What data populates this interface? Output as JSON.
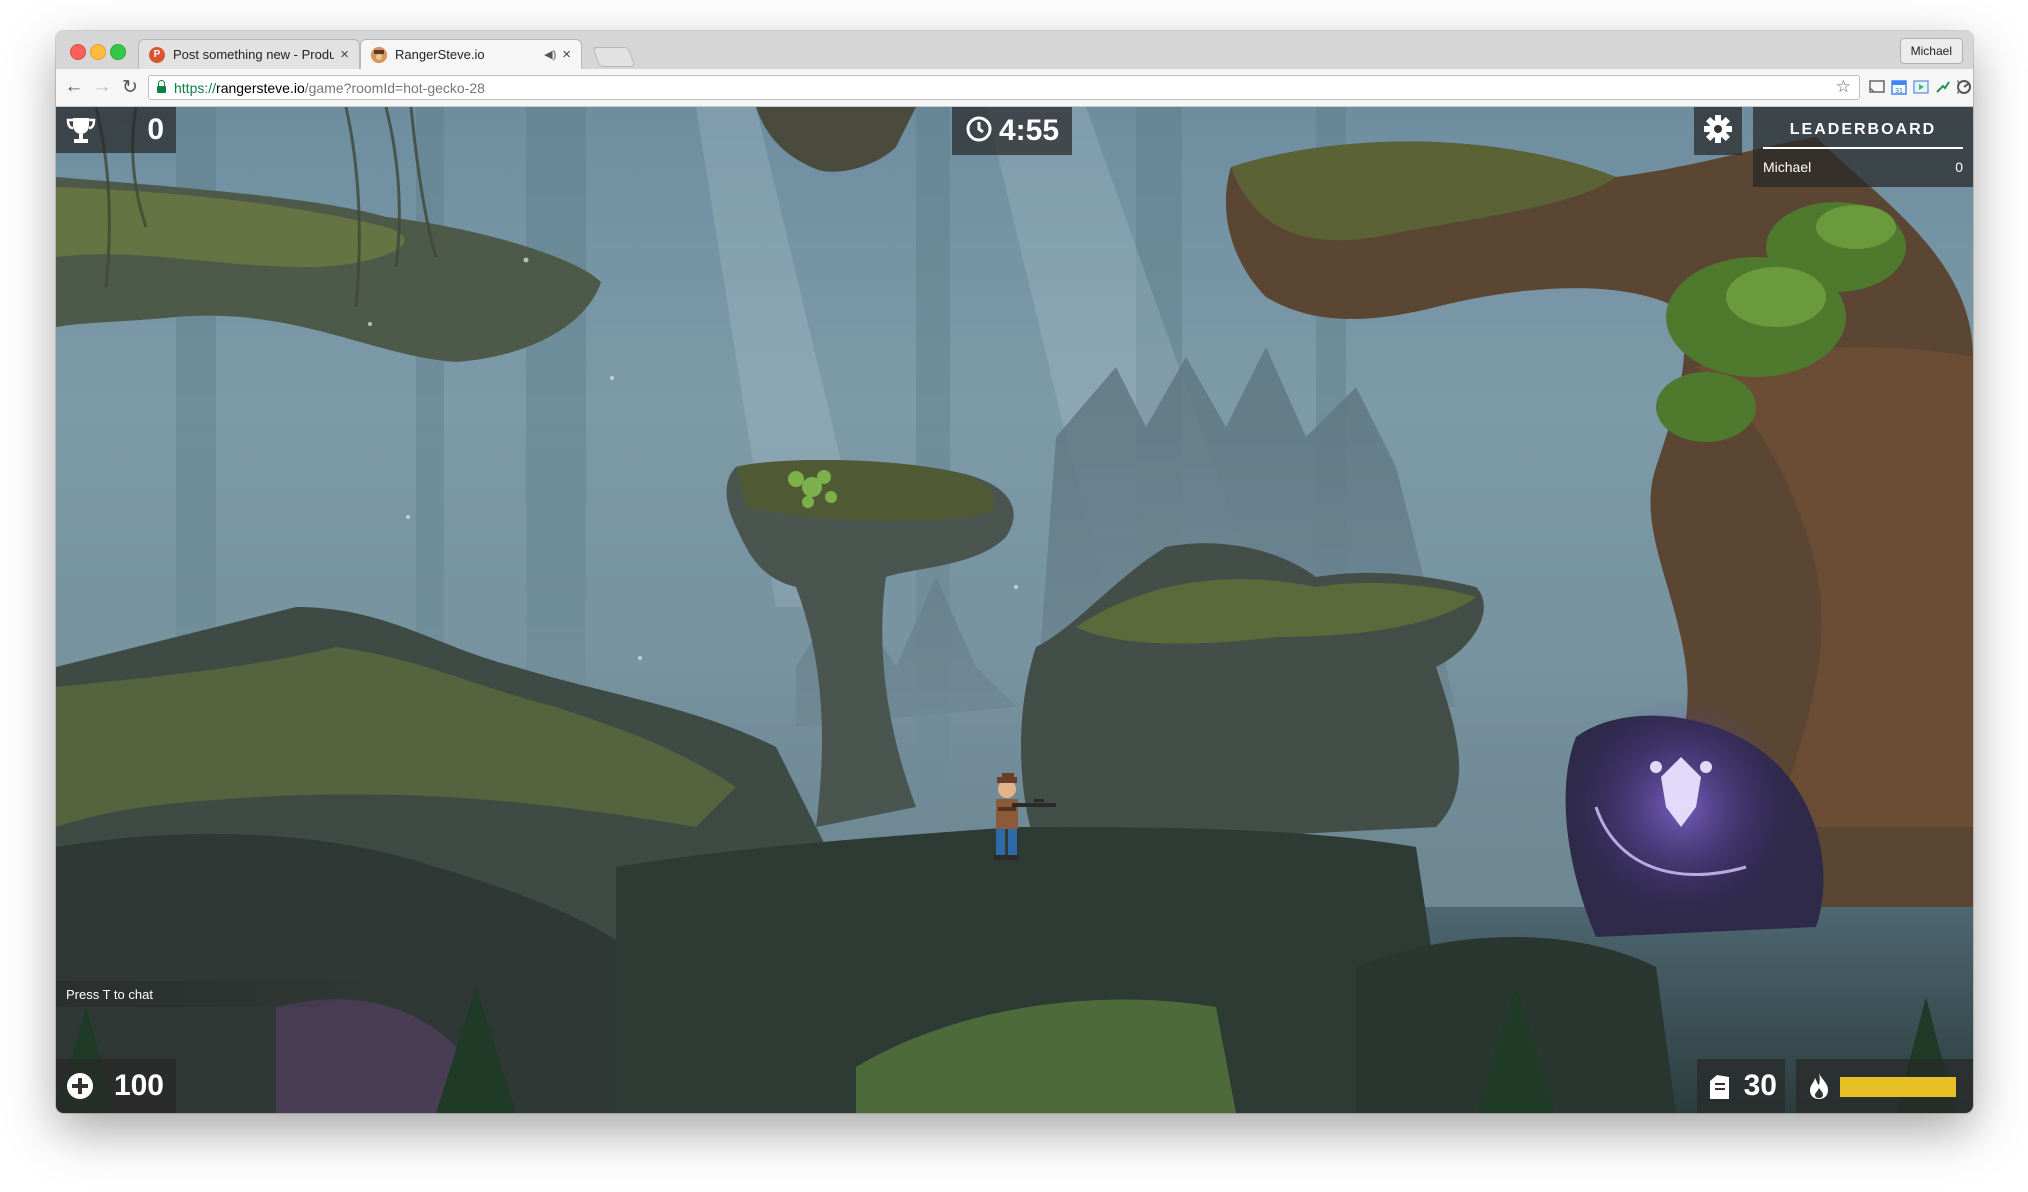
{
  "browser": {
    "tabs": [
      {
        "title": "Post something new - Product Hunt",
        "favicon_letter": "P",
        "favicon_color": "#da552f",
        "active": false
      },
      {
        "title": "RangerSteve.io",
        "active": true
      }
    ],
    "profile_name": "Michael",
    "url": {
      "scheme": "https://",
      "host": "rangersteve.io",
      "path": "/game?roomId=hot-gecko-28"
    }
  },
  "hud": {
    "score": "0",
    "timer": "4:55",
    "leaderboard": {
      "title": "LEADERBOARD",
      "rows": [
        {
          "name": "Michael",
          "score": "0"
        }
      ]
    },
    "health": "100",
    "ammo": "30",
    "jetpack_fuel_percent": 100,
    "chat_hint": "Press T to chat"
  },
  "colors": {
    "jetpack_bar": "#e6c025",
    "hud_background": "#282828"
  }
}
